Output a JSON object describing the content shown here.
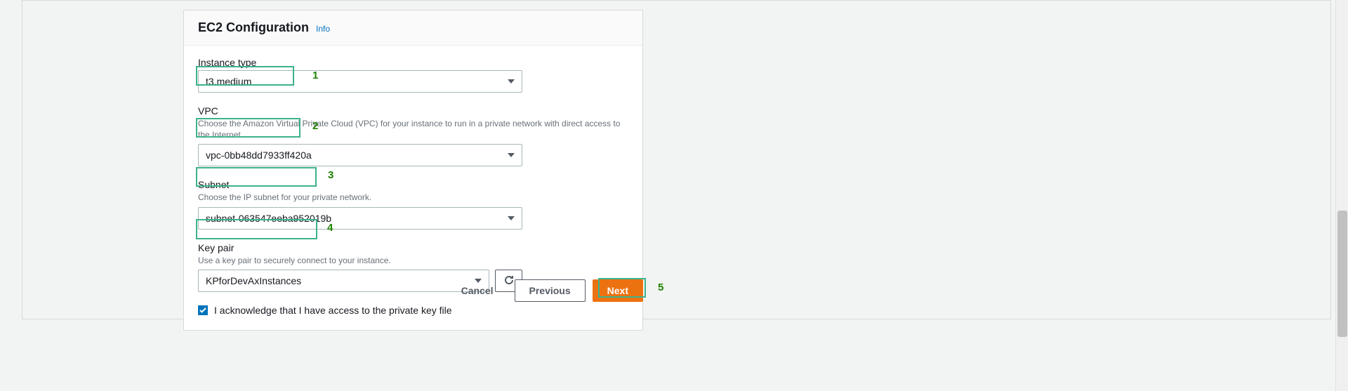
{
  "panel": {
    "title": "EC2 Configuration",
    "info": "Info"
  },
  "fields": {
    "instanceType": {
      "label": "Instance type",
      "value": "t3.medium"
    },
    "vpc": {
      "label": "VPC",
      "help": "Choose the Amazon Virtual Private Cloud (VPC) for your instance to run in a private network with direct access to the Internet.",
      "value": "vpc-0bb48dd7933ff420a"
    },
    "subnet": {
      "label": "Subnet",
      "help": "Choose the IP subnet for your private network.",
      "value": "subnet-063547eeba952019b"
    },
    "keypair": {
      "label": "Key pair",
      "help": "Use a key pair to securely connect to your instance.",
      "value": "KPforDevAxInstances"
    },
    "ack": {
      "label": "I acknowledge that I have access to the private key file",
      "checked": true
    }
  },
  "buttons": {
    "cancel": "Cancel",
    "previous": "Previous",
    "next": "Next"
  },
  "annotations": {
    "a1": "1",
    "a2": "2",
    "a3": "3",
    "a4": "4",
    "a5": "5"
  }
}
